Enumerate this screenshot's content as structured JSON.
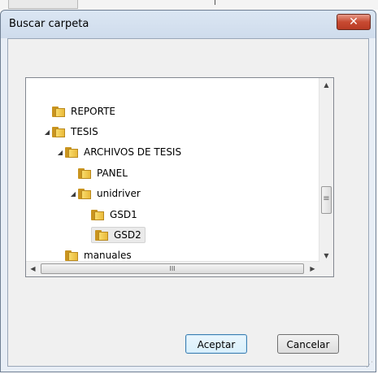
{
  "dialog": {
    "title": "Buscar carpeta",
    "close_symbol": "✕"
  },
  "tree": {
    "items": [
      {
        "label": "REPORTE",
        "arrow": ""
      },
      {
        "label": "TESIS",
        "arrow": "◢"
      },
      {
        "label": "ARCHIVOS DE TESIS",
        "arrow": "◢"
      },
      {
        "label": "PANEL",
        "arrow": ""
      },
      {
        "label": "unidriver",
        "arrow": "◢"
      },
      {
        "label": "GSD1",
        "arrow": ""
      },
      {
        "label": "GSD2",
        "arrow": "",
        "selected": true
      },
      {
        "label": "manuales",
        "arrow": ""
      }
    ],
    "scroll_up": "▲",
    "scroll_down": "▼",
    "scroll_left": "◀",
    "scroll_right": "▶",
    "hthumb_grip": "III",
    "vthumb_grip": "≡"
  },
  "buttons": {
    "ok": "Aceptar",
    "cancel": "Cancelar"
  },
  "icons": {
    "folder": "folder-icon",
    "close": "close-icon"
  },
  "colors": {
    "close_button": "#c74a31",
    "folder": "#f9dc6b",
    "dialog_frame": "#e8eef6"
  }
}
